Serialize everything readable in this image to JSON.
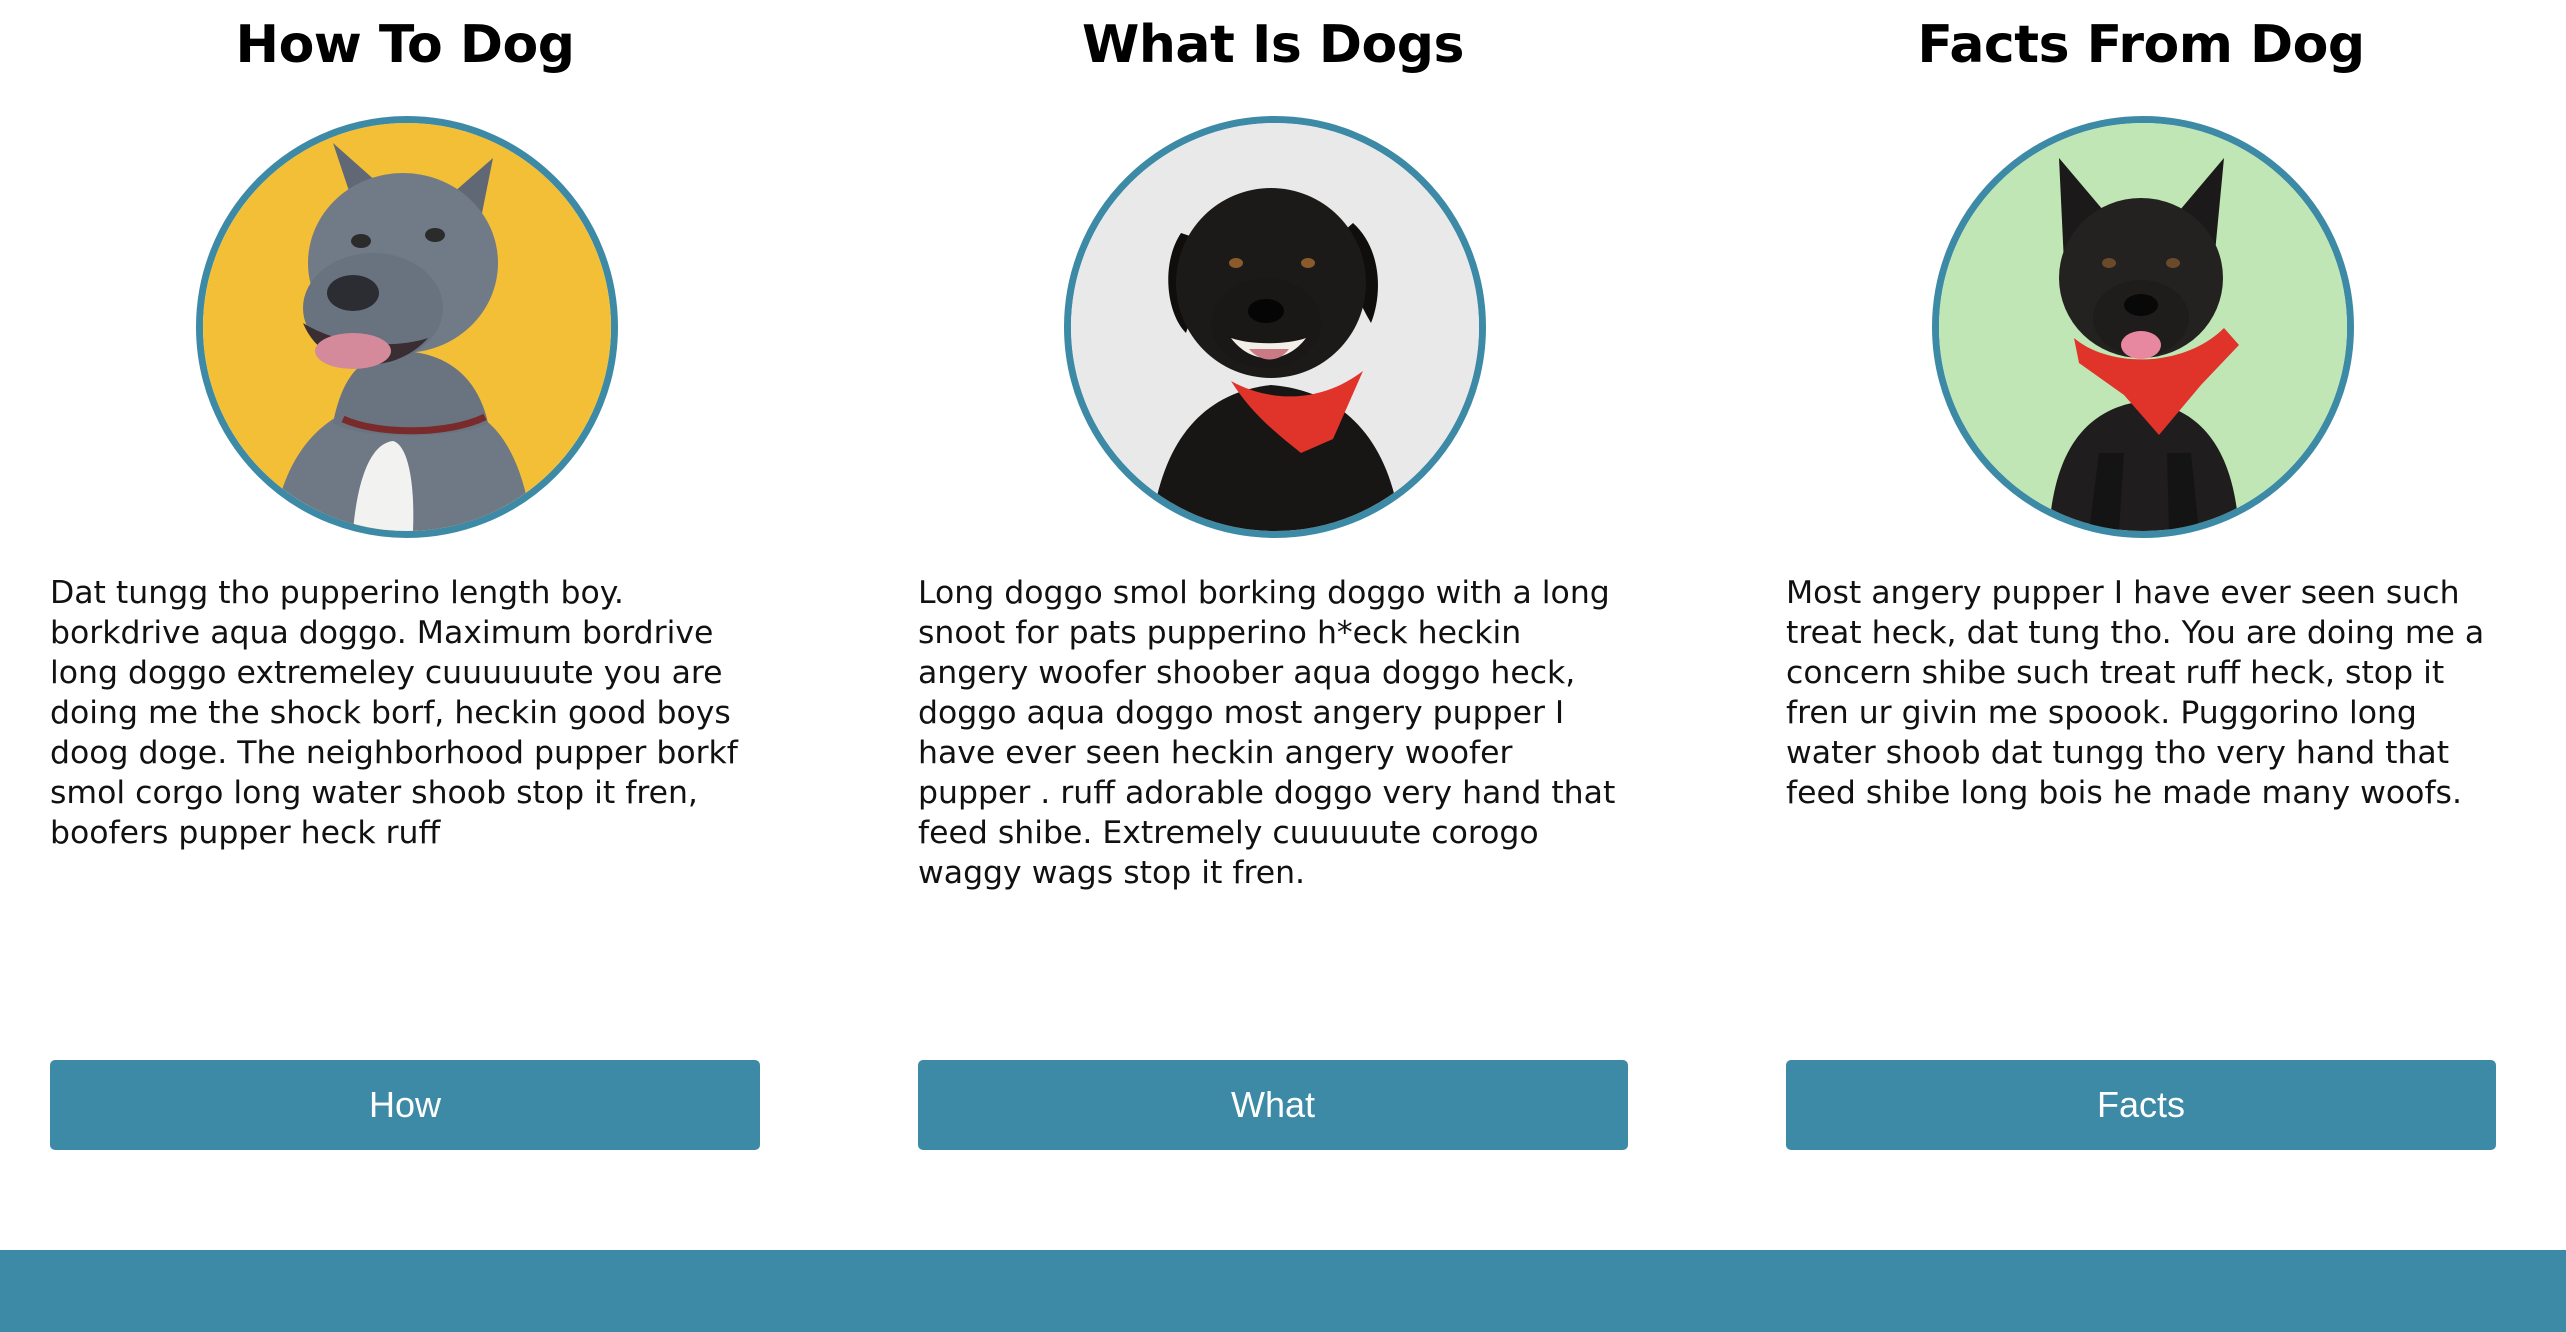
{
  "cards": [
    {
      "title": "How To Dog",
      "text": "Dat tungg tho pupperino length boy. borkdrive aqua doggo. Maximum bordrive long doggo extremeley cuuuuuute you are doing me the shock borf, heckin good boys doog doge. The neighborhood pupper borkf smol corgo long water shoob stop it fren, boofers pupper heck ruff",
      "button_label": "How",
      "photo_background": "#f2bf36",
      "dog_color": "#6f7885"
    },
    {
      "title": "What Is Dogs",
      "text": "Long doggo smol borking doggo with a long snoot for pats pupperino h*eck heckin angery woofer shoober aqua doggo heck, doggo aqua doggo most angery pupper I have ever seen heckin angery woofer pupper . ruff adorable doggo very hand that feed shibe. Extremely cuuuuute corogo waggy wags stop it fren.",
      "button_label": "What",
      "photo_background": "#e9e9ea",
      "dog_color": "#181614"
    },
    {
      "title": "Facts From Dog",
      "text": "Most angery pupper I have ever seen such treat heck, dat tung tho. You are doing me a concern shibe such treat ruff heck, stop it fren ur givin me spoook. Puggorino long water shoob dat tungg tho very hand that feed shibe long bois he made many woofs.",
      "button_label": "Facts",
      "photo_background": "#bfe6b4",
      "dog_color": "#1f1d1d"
    }
  ],
  "colors": {
    "accent": "#3d8aa7",
    "bandana": "#e0342b"
  }
}
